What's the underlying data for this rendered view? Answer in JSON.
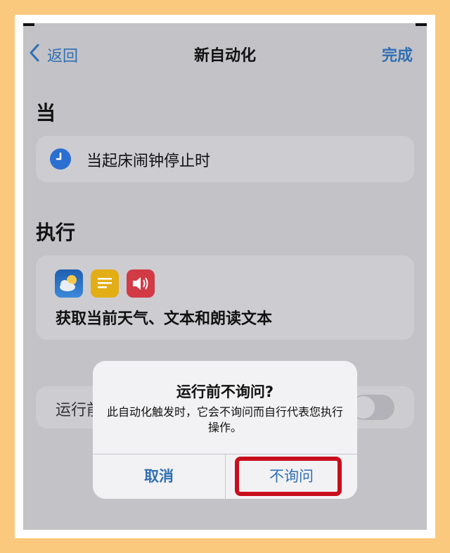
{
  "nav": {
    "back_label": "返回",
    "title": "新自动化",
    "done_label": "完成"
  },
  "when": {
    "section_title": "当",
    "trigger_text": "当起床闹钟停止时",
    "trigger_icon": "clock-icon"
  },
  "do": {
    "section_title": "执行",
    "icons": [
      "weather-icon",
      "text-icon",
      "speak-text-icon"
    ],
    "summary": "获取当前天气、文本和朗读文本"
  },
  "toggle_row": {
    "label_visible": "运行前"
  },
  "alert": {
    "title": "运行前不询问?",
    "message": "此自动化触发时，它会不询问而自行代表您执行操作。",
    "cancel_label": "取消",
    "confirm_label": "不询问"
  },
  "colors": {
    "background_border": "#fac97e",
    "accent_blue": "#2f6fb3",
    "highlight_red": "#c90e1d"
  }
}
